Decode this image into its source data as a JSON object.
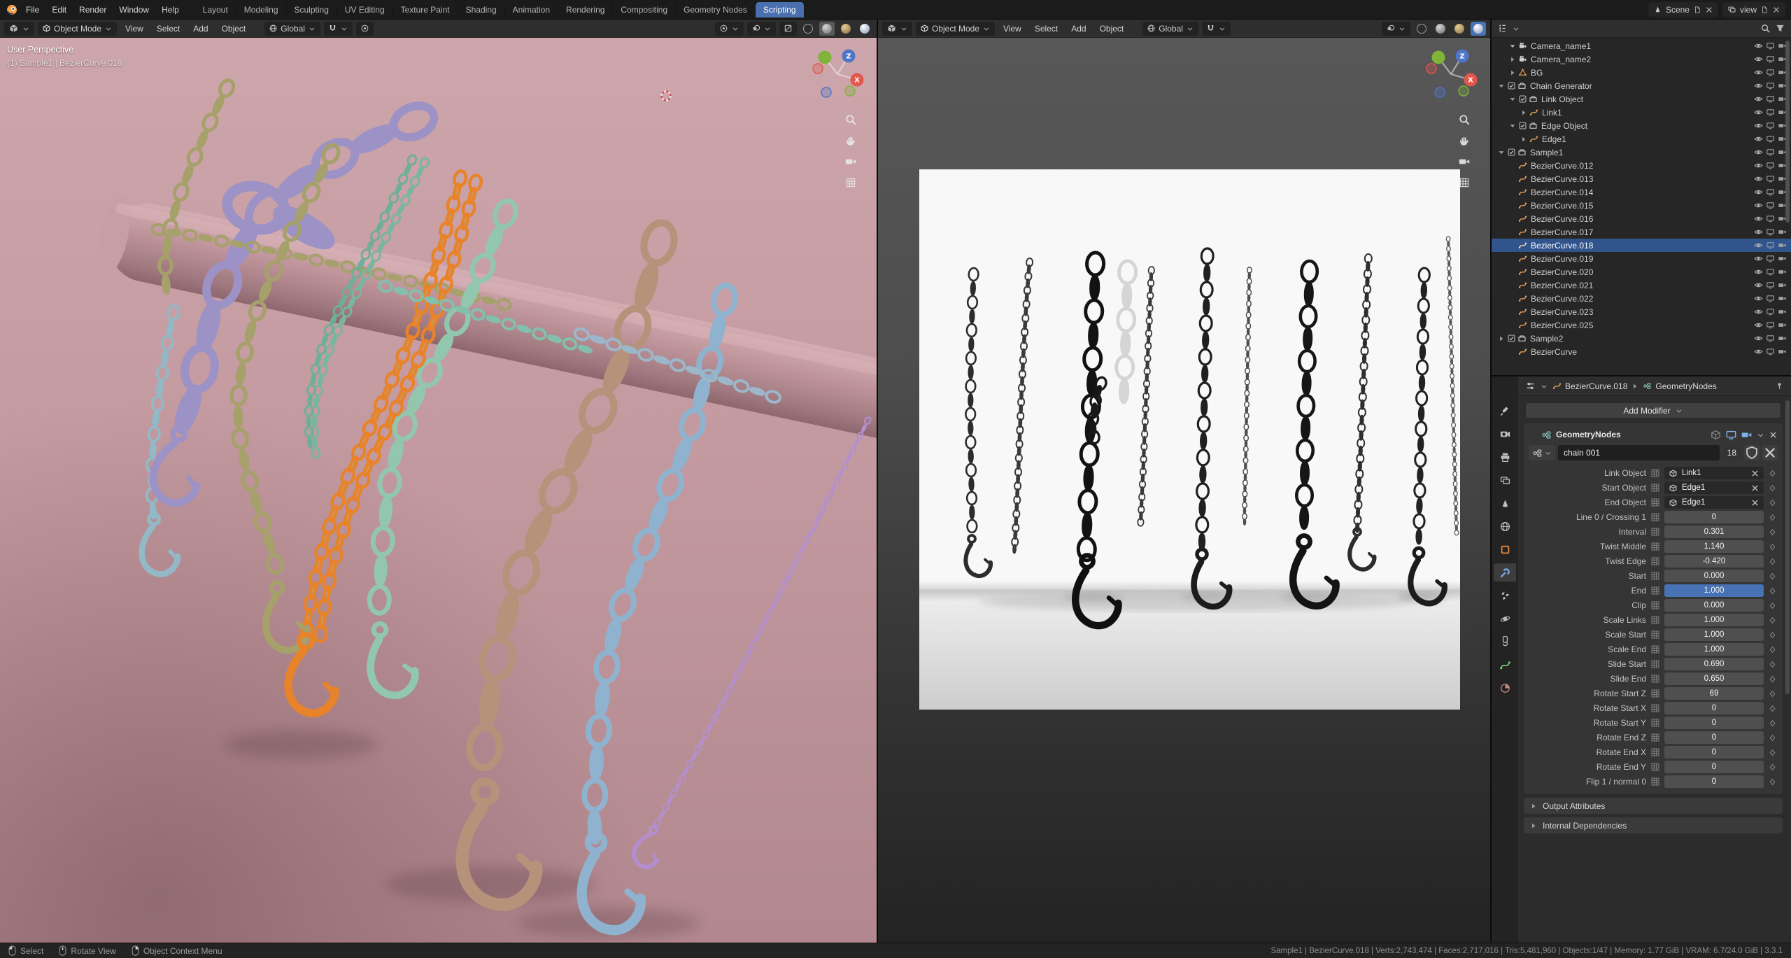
{
  "colors": {
    "accent": "#4772b3",
    "selected_outline": "#e8832a",
    "viewport_left_bg": "#c49ba1"
  },
  "topbar": {
    "app_menus": [
      "File",
      "Edit",
      "Render",
      "Window",
      "Help"
    ],
    "workspaces": [
      "Layout",
      "Modeling",
      "Sculpting",
      "UV Editing",
      "Texture Paint",
      "Shading",
      "Animation",
      "Rendering",
      "Compositing",
      "Geometry Nodes",
      "Scripting"
    ],
    "active_workspace": "Scripting",
    "scene": {
      "label": "Scene"
    },
    "view_layer": {
      "label": "view"
    }
  },
  "gizmo": {
    "x_label": "X",
    "z_label": "Z"
  },
  "viewport_left": {
    "mode": "Object Mode",
    "menus": [
      "View",
      "Select",
      "Add",
      "Object"
    ],
    "orientation": "Global",
    "overlay_line1": "User Perspective",
    "overlay_line2": "(1) Sample1 | BezierCurve.018"
  },
  "viewport_right": {
    "mode": "Object Mode",
    "menus": [
      "View",
      "Select",
      "Add",
      "Object"
    ],
    "orientation": "Global"
  },
  "outliner": {
    "rows": [
      {
        "depth": 1,
        "arrow": "right",
        "type": "camera",
        "label": "Camera_name1"
      },
      {
        "depth": 1,
        "arrow": "right",
        "type": "camera",
        "label": "Camera_name2"
      },
      {
        "depth": 1,
        "arrow": "right",
        "type": "mesh",
        "label": "BG"
      },
      {
        "depth": 0,
        "arrow": "down",
        "type": "collection",
        "label": "Chain Generator",
        "checkbox": true
      },
      {
        "depth": 1,
        "arrow": "down",
        "type": "collection",
        "label": "Link Object",
        "checkbox": true
      },
      {
        "depth": 2,
        "arrow": "right",
        "type": "curve",
        "label": "Link1"
      },
      {
        "depth": 1,
        "arrow": "down",
        "type": "collection",
        "label": "Edge Object",
        "checkbox": true
      },
      {
        "depth": 2,
        "arrow": "right",
        "type": "curve",
        "label": "Edge1"
      },
      {
        "depth": 0,
        "arrow": "down",
        "type": "collection",
        "label": "Sample1",
        "checkbox": true
      },
      {
        "depth": 1,
        "type": "curve",
        "label": "BezierCurve.012"
      },
      {
        "depth": 1,
        "type": "curve",
        "label": "BezierCurve.013"
      },
      {
        "depth": 1,
        "type": "curve",
        "label": "BezierCurve.014"
      },
      {
        "depth": 1,
        "type": "curve",
        "label": "BezierCurve.015"
      },
      {
        "depth": 1,
        "type": "curve",
        "label": "BezierCurve.016"
      },
      {
        "depth": 1,
        "type": "curve",
        "label": "BezierCurve.017"
      },
      {
        "depth": 1,
        "type": "curve",
        "label": "BezierCurve.018",
        "selected": true
      },
      {
        "depth": 1,
        "type": "curve",
        "label": "BezierCurve.019"
      },
      {
        "depth": 1,
        "type": "curve",
        "label": "BezierCurve.020"
      },
      {
        "depth": 1,
        "type": "curve",
        "label": "BezierCurve.021"
      },
      {
        "depth": 1,
        "type": "curve",
        "label": "BezierCurve.022"
      },
      {
        "depth": 1,
        "type": "curve",
        "label": "BezierCurve.023"
      },
      {
        "depth": 1,
        "type": "curve",
        "label": "BezierCurve.025"
      },
      {
        "depth": 0,
        "arrow": "right",
        "type": "collection",
        "label": "Sample2",
        "checkbox": true
      },
      {
        "depth": 1,
        "type": "curve",
        "label": "BezierCurve"
      }
    ]
  },
  "properties": {
    "tabs": [
      "tool",
      "render",
      "output",
      "view-layer",
      "scene",
      "world",
      "object",
      "modifiers",
      "particles",
      "physics",
      "constraints",
      "object-data",
      "material"
    ],
    "active_tab": "modifiers",
    "breadcrumb": {
      "object": "BezierCurve.018",
      "tree": "GeometryNodes"
    },
    "add_modifier_label": "Add Modifier",
    "modifier": {
      "name": "GeometryNodes",
      "node_tree": "chain 001",
      "users_count": "18",
      "fields": [
        {
          "label": "Link Object",
          "value": "Link1",
          "type": "object"
        },
        {
          "label": "Start Object",
          "value": "Edge1",
          "type": "object"
        },
        {
          "label": "End Object",
          "value": "Edge1",
          "type": "object"
        },
        {
          "label": "Line 0 / Crossing 1",
          "value": "0"
        },
        {
          "label": "Interval",
          "value": "0.301"
        },
        {
          "label": "Twist Middle",
          "value": "1.140"
        },
        {
          "label": "Twist Edge",
          "value": "-0.420"
        },
        {
          "label": "Start",
          "value": "0.000"
        },
        {
          "label": "End",
          "value": "1.000",
          "highlight": true
        },
        {
          "label": "Clip",
          "value": "0.000"
        },
        {
          "label": "Scale Links",
          "value": "1.000"
        },
        {
          "label": "Scale Start",
          "value": "1.000"
        },
        {
          "label": "Scale End",
          "value": "1.000"
        },
        {
          "label": "Slide Start",
          "value": "0.690"
        },
        {
          "label": "Slide End",
          "value": "0.650"
        },
        {
          "label": "Rotate Start Z",
          "value": "69"
        },
        {
          "label": "Rotate Start X",
          "value": "0"
        },
        {
          "label": "Rotate Start Y",
          "value": "0"
        },
        {
          "label": "Rotate End Z",
          "value": "0"
        },
        {
          "label": "Rotate End X",
          "value": "0"
        },
        {
          "label": "Rotate End Y",
          "value": "0"
        },
        {
          "label": "Flip 1 / normal 0",
          "value": "0"
        }
      ],
      "sections": [
        "Output Attributes",
        "Internal Dependencies"
      ]
    }
  },
  "statusbar": {
    "hints": [
      {
        "button": "left",
        "label": "Select"
      },
      {
        "button": "middle",
        "label": "Rotate View"
      },
      {
        "button": "right",
        "label": "Object Context Menu"
      }
    ],
    "stats": [
      "Sample1 | BezierCurve.018",
      "Verts:2,743,474",
      "Faces:2,717,016",
      "Tris:5,481,960",
      "Objects:1/47",
      "Memory: 1.77 GiB",
      "VRAM: 6.7/24.0 GiB",
      "3.3.1"
    ]
  }
}
